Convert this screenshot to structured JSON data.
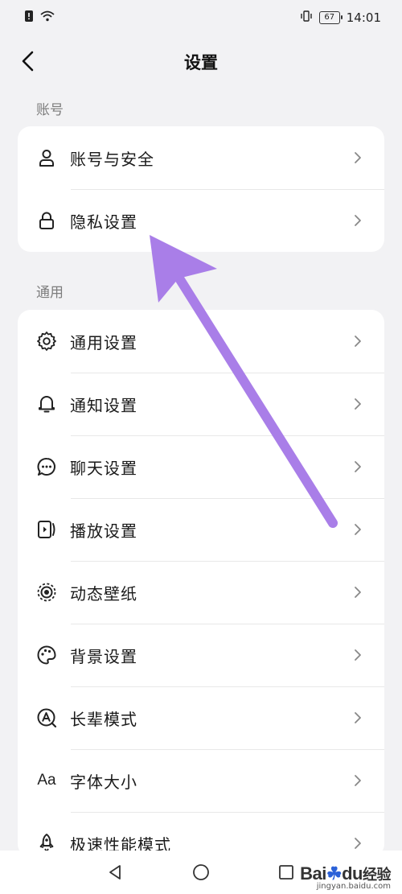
{
  "status_bar": {
    "battery": "67",
    "time": "14:01"
  },
  "header": {
    "title": "设置"
  },
  "sections": {
    "account": {
      "label": "账号",
      "items": [
        {
          "label": "账号与安全",
          "icon": "user-icon"
        },
        {
          "label": "隐私设置",
          "icon": "lock-icon"
        }
      ]
    },
    "general": {
      "label": "通用",
      "items": [
        {
          "label": "通用设置",
          "icon": "gear-icon"
        },
        {
          "label": "通知设置",
          "icon": "bell-icon"
        },
        {
          "label": "聊天设置",
          "icon": "chat-bubble-icon"
        },
        {
          "label": "播放设置",
          "icon": "playback-icon"
        },
        {
          "label": "动态壁纸",
          "icon": "live-wallpaper-icon"
        },
        {
          "label": "背景设置",
          "icon": "palette-icon"
        },
        {
          "label": "长辈模式",
          "icon": "elder-mode-icon"
        },
        {
          "label": "字体大小",
          "icon": "font-size-icon",
          "icon_text": "Aa"
        },
        {
          "label": "极速性能模式",
          "icon": "rocket-icon"
        }
      ]
    }
  },
  "watermark": {
    "logo_part1": "Bai",
    "logo_part2": "du",
    "logo_part3": "经验",
    "url": "jingyan.baidu.com"
  },
  "annotation": {
    "color": "#a97ee8"
  }
}
